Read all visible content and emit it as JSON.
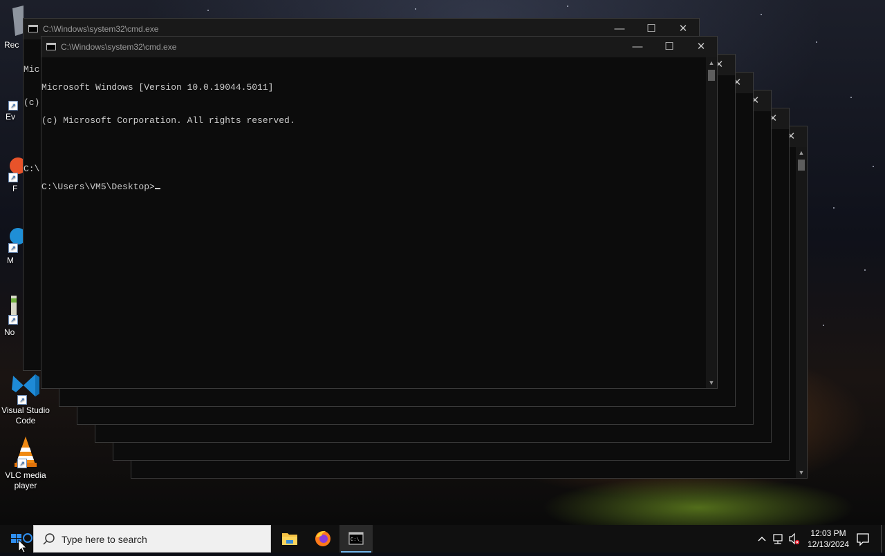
{
  "desktop": {
    "icons": [
      {
        "label": "Rec",
        "icon": "recycle-bin-icon"
      },
      {
        "label": "Ev",
        "icon": "everything-icon"
      },
      {
        "label": "F",
        "icon": "firefox-icon"
      },
      {
        "label": "M",
        "icon": "edge-icon"
      },
      {
        "label": "No",
        "icon": "notepad-icon"
      },
      {
        "label": "Visual Studio Code",
        "icon": "vscode-icon"
      },
      {
        "label": "VLC media player",
        "icon": "vlc-icon"
      }
    ]
  },
  "windows": {
    "back": {
      "title": "C:\\Windows\\system32\\cmd.exe",
      "lines": [
        "Mic",
        "(c)",
        "",
        "C:\\"
      ]
    },
    "front": {
      "title": "C:\\Windows\\system32\\cmd.exe",
      "lines": [
        "Microsoft Windows [Version 10.0.19044.5011]",
        "(c) Microsoft Corporation. All rights reserved.",
        "",
        "C:\\Users\\VM5\\Desktop>"
      ]
    },
    "controls": {
      "minimize": "—",
      "maximize": "☐",
      "close": "✕"
    }
  },
  "taskbar": {
    "search_placeholder": "Type here to search",
    "apps": [
      "file-explorer-icon",
      "firefox-icon",
      "cmd-icon"
    ],
    "time": "12:03 PM",
    "date": "12/13/2024"
  },
  "colors": {
    "console_bg": "#0c0c0c",
    "console_text": "#cccccc",
    "titlebar_bg": "#191919",
    "taskbar_bg": "#101010",
    "active_indicator": "#76b9ed"
  }
}
